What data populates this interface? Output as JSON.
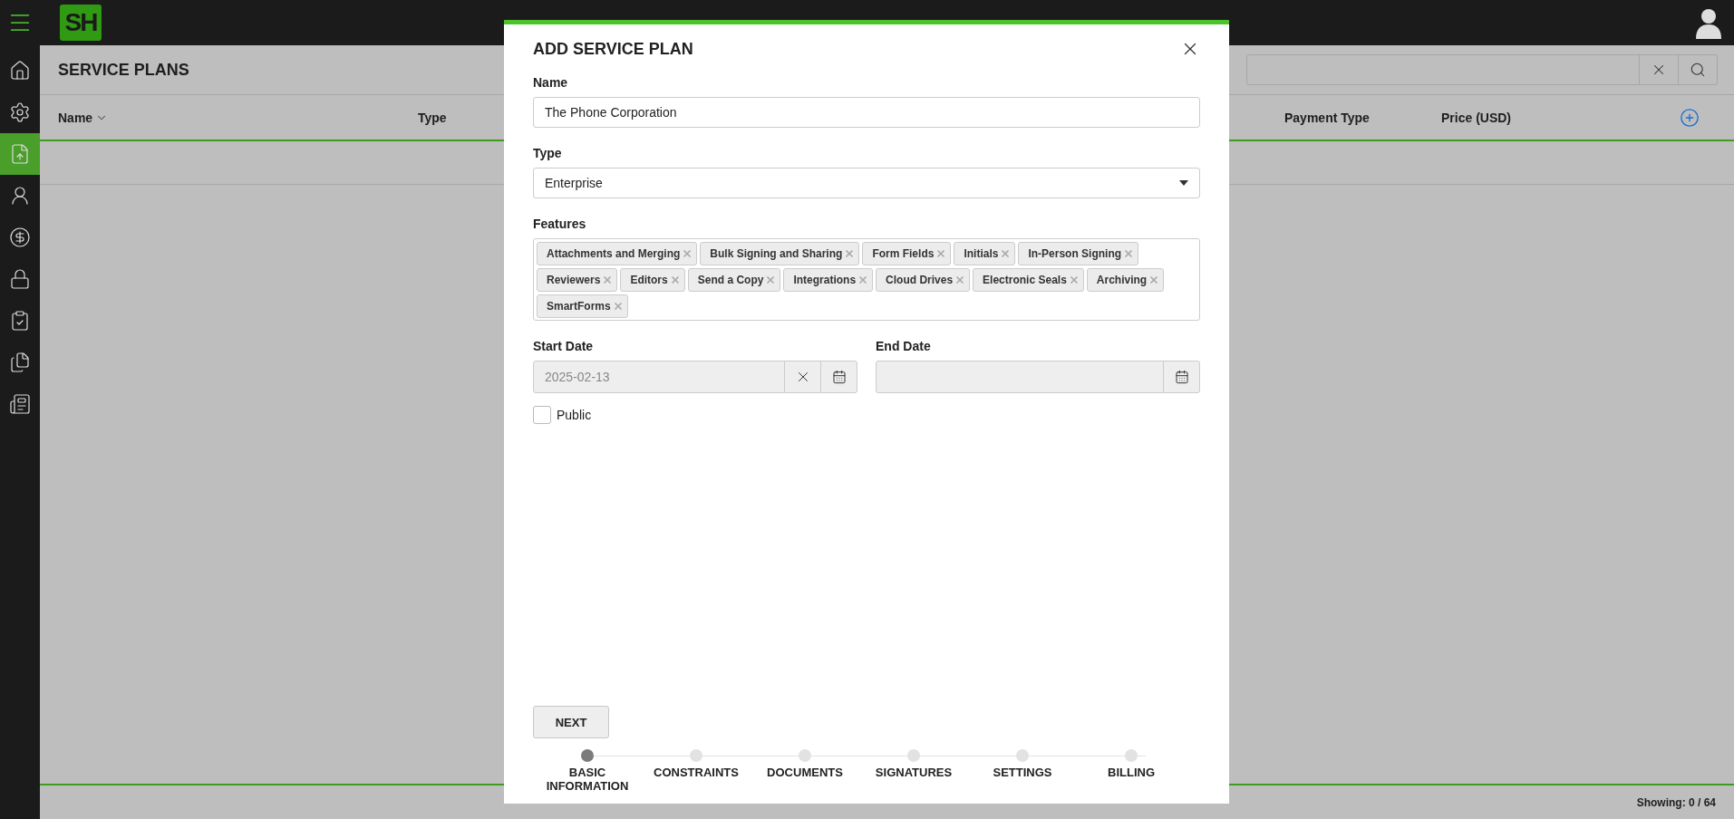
{
  "app": {
    "logo": "SH"
  },
  "sidebar": {
    "items": [
      {
        "kind": "home",
        "selected": false
      },
      {
        "kind": "settings",
        "selected": false
      },
      {
        "kind": "upload",
        "selected": true
      },
      {
        "kind": "user",
        "selected": false
      },
      {
        "kind": "dollar",
        "selected": false
      },
      {
        "kind": "lock",
        "selected": false
      },
      {
        "kind": "clipboard",
        "selected": false
      },
      {
        "kind": "files",
        "selected": false
      },
      {
        "kind": "report",
        "selected": false
      }
    ]
  },
  "page": {
    "title": "SERVICE PLANS"
  },
  "table": {
    "columns": [
      {
        "label": "Name",
        "sorted": true
      },
      {
        "label": "Type",
        "sorted": false
      },
      {
        "label": "Payment Type",
        "sorted": false
      },
      {
        "label": "Price (USD)",
        "sorted": false
      }
    ]
  },
  "status_bar": {
    "text": "Showing: 0 / 64"
  },
  "dialog": {
    "title": "ADD SERVICE PLAN",
    "name": {
      "label": "Name",
      "value": "The Phone Corporation"
    },
    "type": {
      "label": "Type",
      "value": "Enterprise"
    },
    "features": {
      "label": "Features",
      "tags": [
        "Attachments and Merging",
        "Bulk Signing and Sharing",
        "Form Fields",
        "Initials",
        "In-Person Signing",
        "Reviewers",
        "Editors",
        "Send a Copy",
        "Integrations",
        "Cloud Drives",
        "Electronic Seals",
        "Archiving",
        "SmartForms"
      ]
    },
    "start_date": {
      "label": "Start Date",
      "value": "2025-02-13"
    },
    "end_date": {
      "label": "End Date"
    },
    "public": {
      "label": "Public",
      "checked": false
    },
    "next_button": "NEXT",
    "steps": [
      {
        "label": "BASIC INFORMATION",
        "selected": true
      },
      {
        "label": "CONSTRAINTS",
        "selected": false
      },
      {
        "label": "DOCUMENTS",
        "selected": false
      },
      {
        "label": "SIGNATURES",
        "selected": false
      },
      {
        "label": "SETTINGS",
        "selected": false
      },
      {
        "label": "BILLING",
        "selected": false
      }
    ]
  }
}
